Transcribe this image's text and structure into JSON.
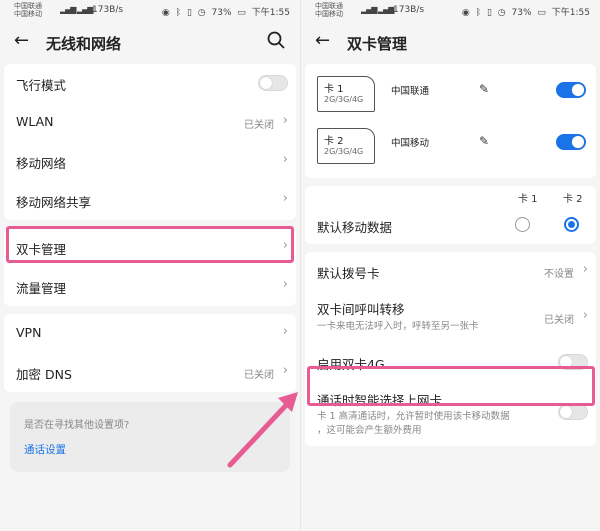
{
  "status": {
    "carrier1": "中国联通",
    "carrier2": "中国移动",
    "speed": "173B/s",
    "battery": "73%",
    "time": "下午1:55"
  },
  "left": {
    "title": "无线和网络",
    "items": {
      "airplane": "飞行模式",
      "wlan": "WLAN",
      "wlan_value": "已关闭",
      "mobile_network": "移动网络",
      "tethering": "移动网络共享",
      "dual_sim": "双卡管理",
      "data_usage": "流量管理",
      "vpn": "VPN",
      "private_dns": "加密 DNS",
      "private_dns_value": "已关闭"
    },
    "suggest": {
      "question": "是否在寻找其他设置项?",
      "link": "通话设置"
    }
  },
  "right": {
    "title": "双卡管理",
    "sim1": {
      "name": "卡 1",
      "type": "2G/3G/4G",
      "operator": "中国联通",
      "enabled": true
    },
    "sim2": {
      "name": "卡 2",
      "type": "2G/3G/4G",
      "operator": "中国移动",
      "enabled": true
    },
    "col1": "卡 1",
    "col2": "卡 2",
    "default_data": "默认移动数据",
    "default_data_selected": "卡 2",
    "default_dial": "默认拨号卡",
    "default_dial_value": "不设置",
    "forward": "双卡间呼叫转移",
    "forward_desc": "一卡来电无法呼入时，呼转至另一张卡",
    "forward_value": "已关闭",
    "dual4g": "启用双卡4G",
    "smart": "通话时智能选择上网卡",
    "smart_desc1": "卡 1 高清通话时，允许暂时使用该卡移动数据",
    "smart_desc2": "，这可能会产生额外费用"
  },
  "colors": {
    "accent": "#1a73e8",
    "highlight": "#e75c92"
  }
}
